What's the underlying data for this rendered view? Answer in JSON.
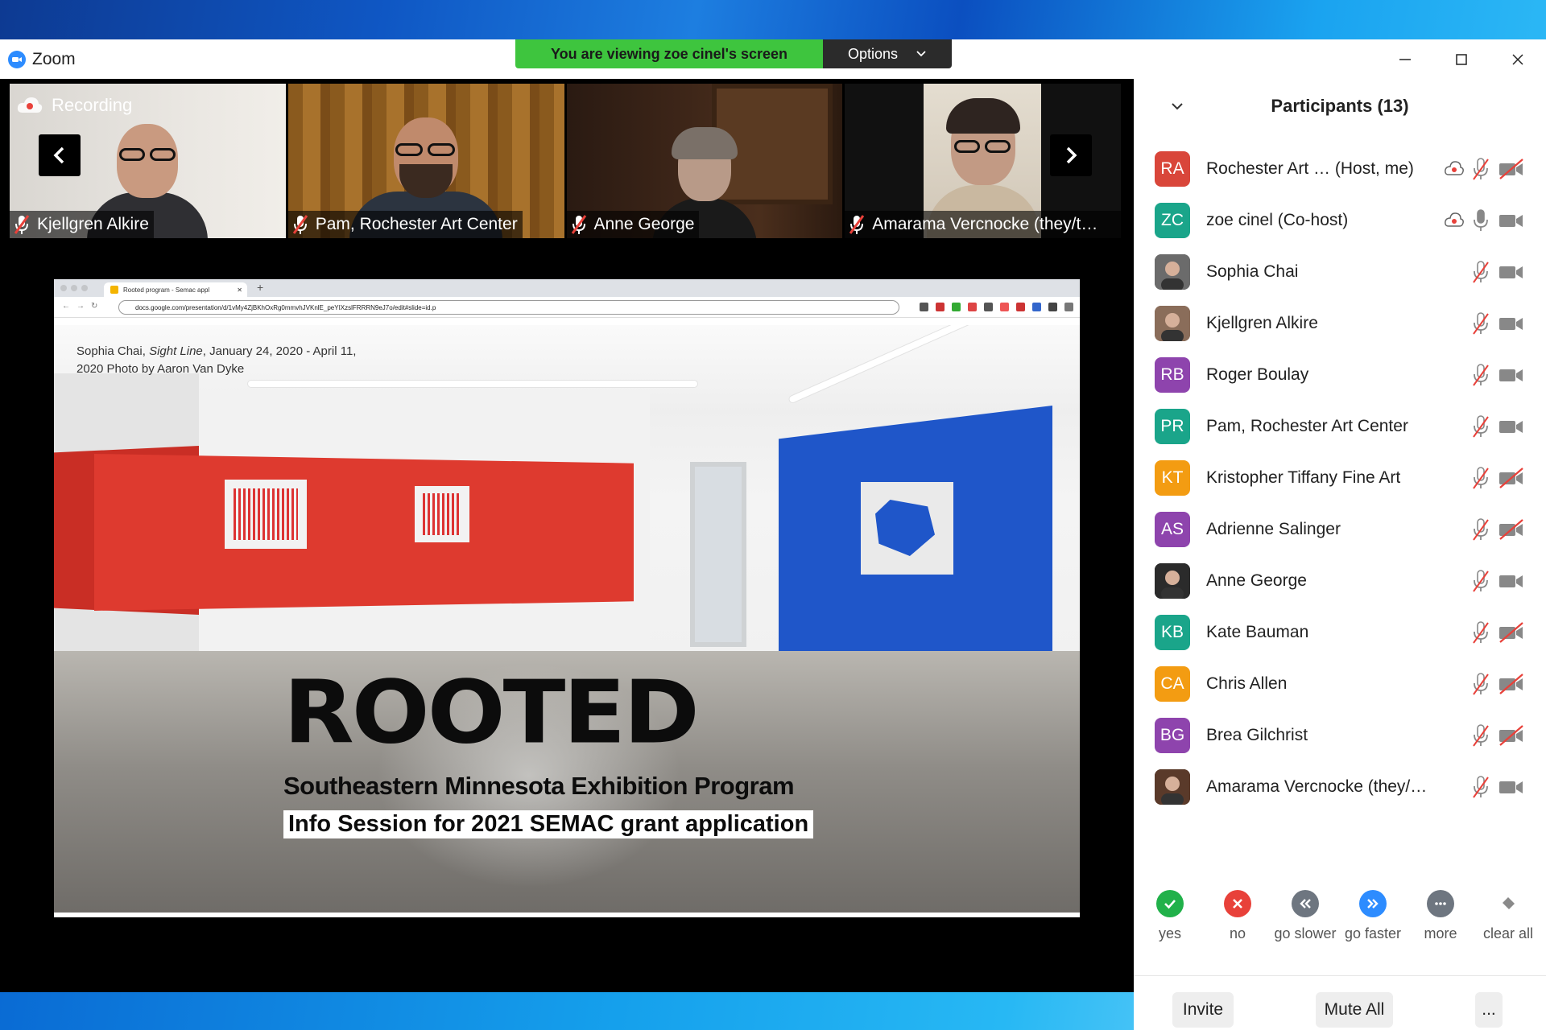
{
  "window": {
    "title": "Zoom"
  },
  "share": {
    "banner": "You are viewing zoe cinel's screen",
    "options_label": "Options"
  },
  "recording": {
    "label": "Recording"
  },
  "tiles": [
    {
      "name": "Kjellgren Alkire"
    },
    {
      "name": "Pam, Rochester Art Center"
    },
    {
      "name": "Anne George"
    },
    {
      "name": "Amarama Vercnocke (they/t…"
    }
  ],
  "browser": {
    "tab_title": "Rooted program - Semac appl",
    "url": "docs.google.com/presentation/d/1vMy4ZjBKhOxRg0mmvhJVKnlE_peYIXzslFRRRN9eJ7o/edit#slide=id.p"
  },
  "slide": {
    "caption_line1_prefix": "Sophia Chai, ",
    "caption_line1_italic": "Sight Line",
    "caption_line1_suffix": ", January 24, 2020 - April 11,",
    "caption_line2": "2020 Photo by Aaron Van Dyke",
    "title": "ROOTED",
    "subtitle": "Southeastern Minnesota Exhibition Program",
    "info": "Info Session for 2021 SEMAC grant application"
  },
  "participants": {
    "title": "Participants (13)",
    "items": [
      {
        "initials": "RA",
        "name": "Rochester Art … (Host, me)",
        "color": "#d9463a",
        "recording": true,
        "mic_muted": true,
        "video_off": true
      },
      {
        "initials": "ZC",
        "name": "zoe cinel (Co-host)",
        "color": "#1aa58a",
        "recording": true,
        "mic_muted": false,
        "video_off": false
      },
      {
        "initials": "",
        "name": "Sophia Chai",
        "color": "#6b6b6b",
        "photo": true,
        "mic_muted": true,
        "video_off": false
      },
      {
        "initials": "",
        "name": "Kjellgren Alkire",
        "color": "#8a6d5a",
        "photo": true,
        "mic_muted": true,
        "video_off": false
      },
      {
        "initials": "RB",
        "name": "Roger Boulay",
        "color": "#8e44ad",
        "mic_muted": true,
        "video_off": false
      },
      {
        "initials": "PR",
        "name": "Pam, Rochester Art Center",
        "color": "#1aa58a",
        "mic_muted": true,
        "video_off": false
      },
      {
        "initials": "KT",
        "name": "Kristopher Tiffany Fine Art",
        "color": "#f39c12",
        "mic_muted": true,
        "video_off": true
      },
      {
        "initials": "AS",
        "name": "Adrienne Salinger",
        "color": "#8e44ad",
        "mic_muted": true,
        "video_off": true
      },
      {
        "initials": "",
        "name": "Anne George",
        "color": "#2b2b2b",
        "photo": true,
        "mic_muted": true,
        "video_off": false
      },
      {
        "initials": "KB",
        "name": "Kate Bauman",
        "color": "#1aa58a",
        "mic_muted": true,
        "video_off": true
      },
      {
        "initials": "CA",
        "name": "Chris Allen",
        "color": "#f39c12",
        "mic_muted": true,
        "video_off": true
      },
      {
        "initials": "BG",
        "name": "Brea Gilchrist",
        "color": "#8e44ad",
        "mic_muted": true,
        "video_off": true
      },
      {
        "initials": "",
        "name": "Amarama Vercnocke (they/…",
        "color": "#5a3a2a",
        "photo": true,
        "mic_muted": true,
        "video_off": false
      }
    ]
  },
  "reactions": [
    {
      "label": "yes",
      "icon": "check-icon",
      "color": "#21b14a"
    },
    {
      "label": "no",
      "icon": "x-icon",
      "color": "#e8413a"
    },
    {
      "label": "go slower",
      "icon": "rewind-icon",
      "color": "#6e7680"
    },
    {
      "label": "go faster",
      "icon": "fast-forward-icon",
      "color": "#2d8cff"
    },
    {
      "label": "more",
      "icon": "more-icon",
      "color": "#6e7680"
    },
    {
      "label": "clear all",
      "icon": "eraser-icon",
      "color": "#9a9a9a"
    }
  ],
  "footer": {
    "invite": "Invite",
    "mute_all": "Mute All",
    "more": "..."
  }
}
